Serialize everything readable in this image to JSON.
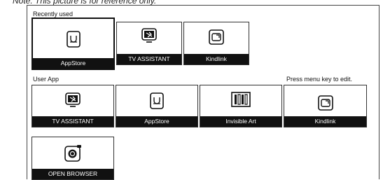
{
  "note": "Note: This picture is for reference only.",
  "recent": {
    "label": "Recently used",
    "items": [
      {
        "label": "AppStore",
        "icon": "appstore-icon"
      },
      {
        "label": "TV ASSISTANT",
        "icon": "tv-assistant-icon"
      },
      {
        "label": "Kindlink",
        "icon": "kindlink-icon"
      }
    ]
  },
  "user": {
    "label": "User App",
    "hint": "Press menu key to edit.",
    "items": [
      {
        "label": "TV ASSISTANT",
        "icon": "tv-assistant-icon"
      },
      {
        "label": "AppStore",
        "icon": "appstore-icon"
      },
      {
        "label": "Invisible Art",
        "icon": "invisible-art-icon"
      },
      {
        "label": "Kindlink",
        "icon": "kindlink-icon"
      },
      {
        "label": "OPEN BROWSER",
        "icon": "browser-icon"
      }
    ]
  },
  "menu_icon": "menu-list-icon"
}
